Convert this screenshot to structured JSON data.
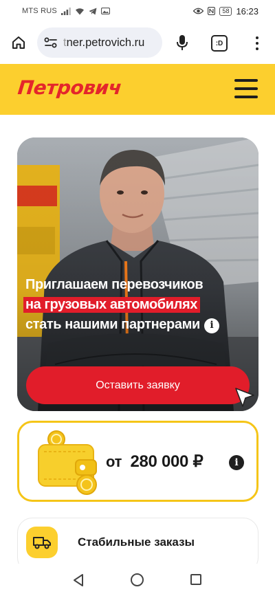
{
  "status_bar": {
    "carrier": "MTS RUS",
    "battery": "58",
    "time": "16:23",
    "icons": [
      "signal-icon",
      "wifi-icon",
      "telegram-icon",
      "gallery-icon",
      "eye-icon",
      "nfc-icon"
    ]
  },
  "browser": {
    "url_prefix": "t",
    "url": "ner.petrovich.ru",
    "tabs_label": ":D"
  },
  "site": {
    "logo": "Петрович",
    "brand_yellow": "#fccf2e",
    "brand_red": "#e11d2a"
  },
  "hero": {
    "line1": "Приглашаем перевозчиков",
    "line2": "на грузовых автомобилях",
    "line3": "стать нашими партнерами",
    "info_symbol": "i",
    "cta_label": "Оставить заявку"
  },
  "income": {
    "prefix": "от",
    "amount": "280 000 ₽",
    "info_symbol": "i"
  },
  "feature": {
    "title": "Стабильные заказы"
  }
}
